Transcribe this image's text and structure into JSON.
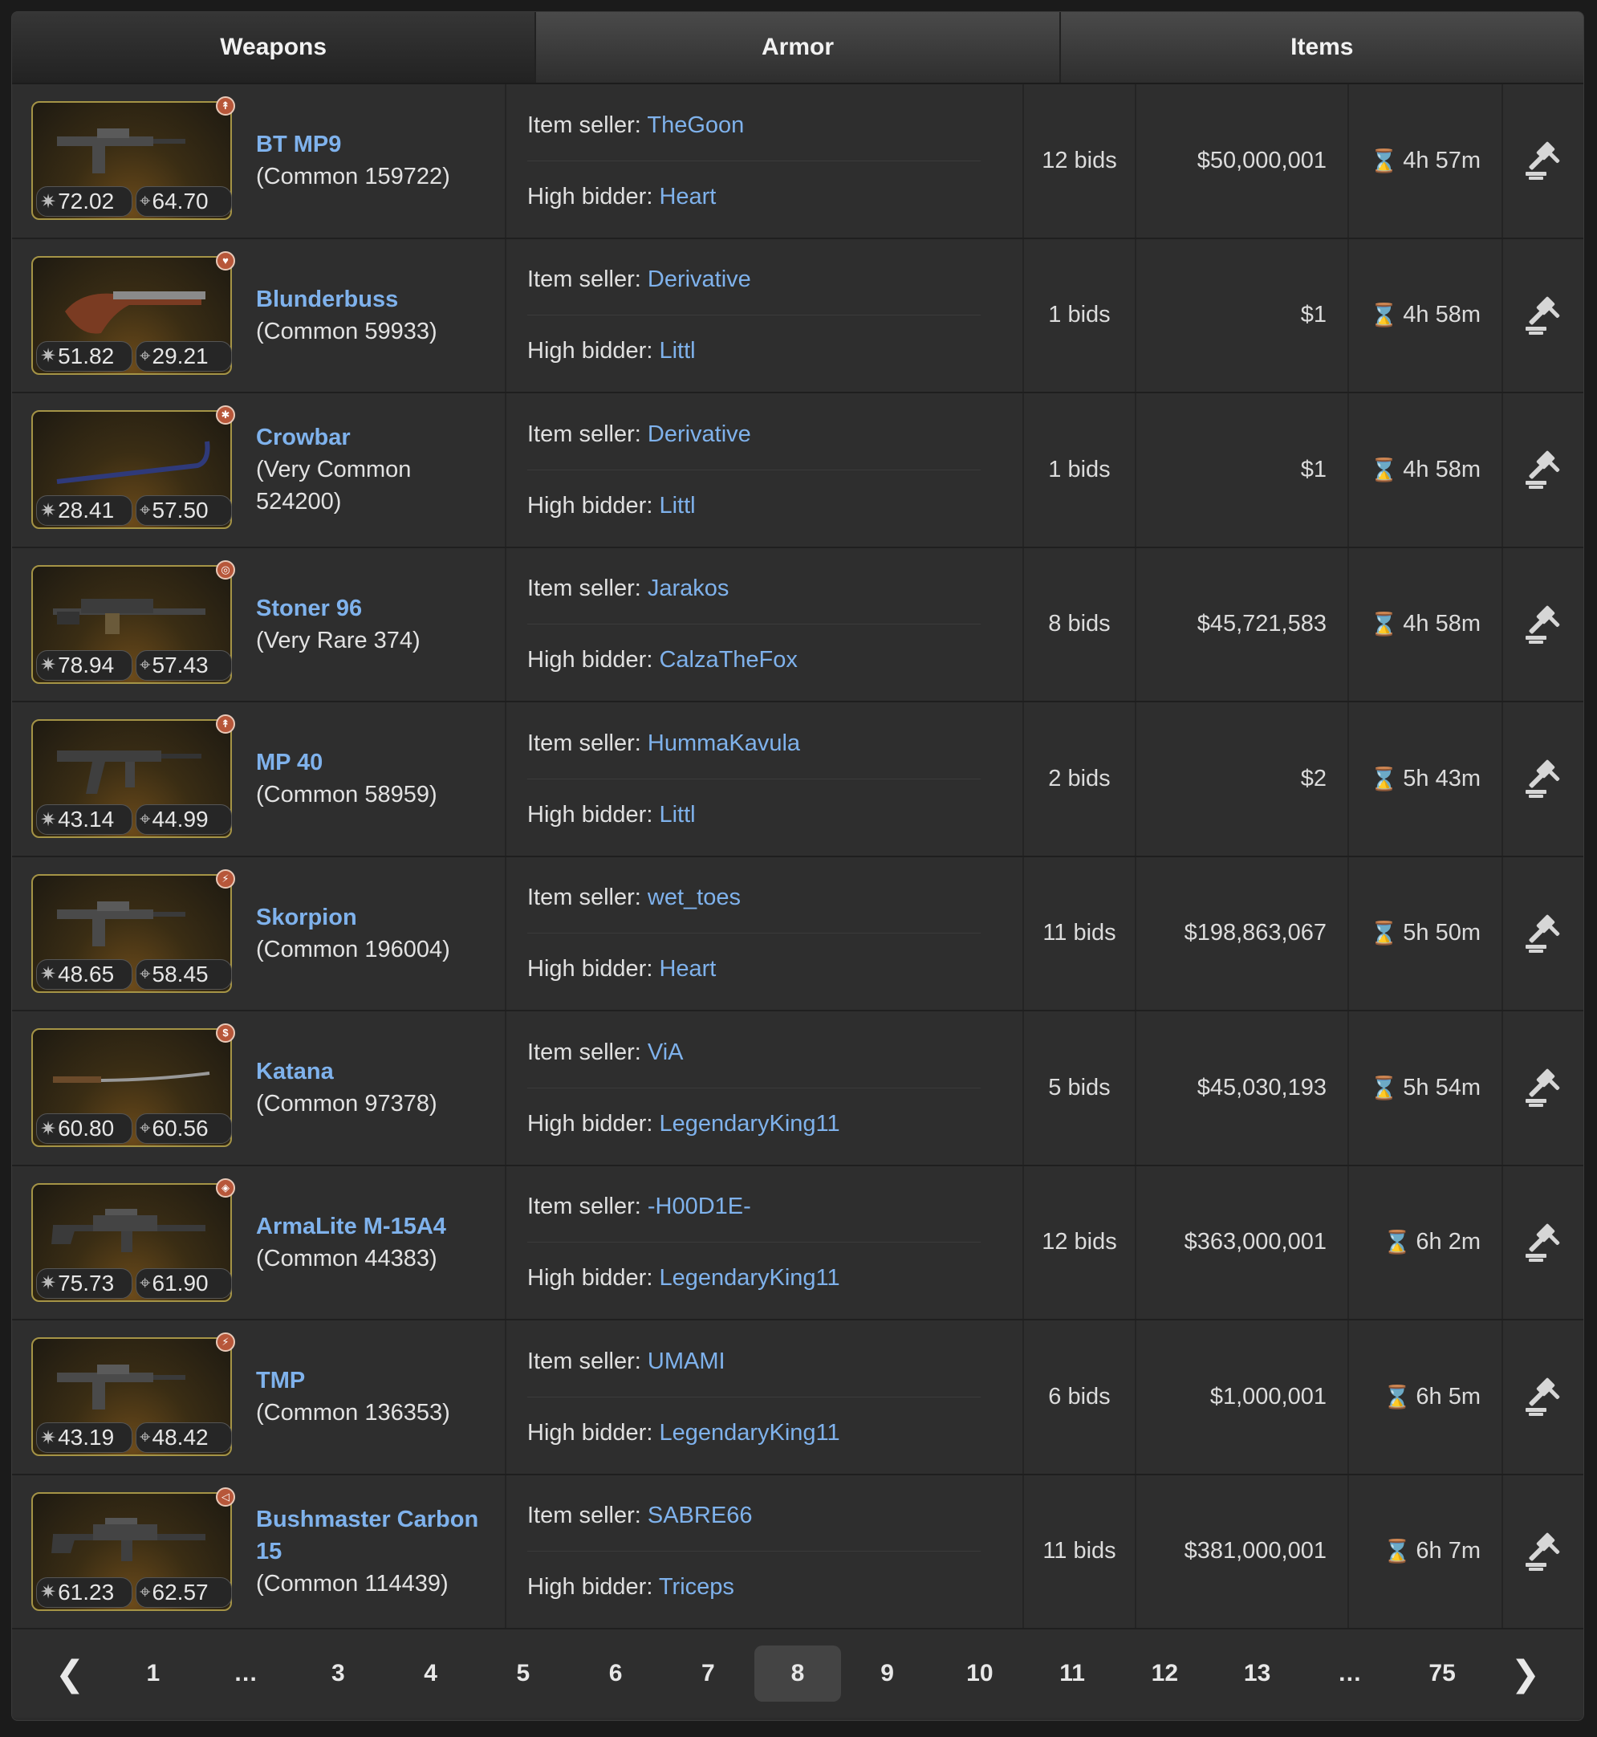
{
  "tabs": [
    "Weapons",
    "Armor",
    "Items"
  ],
  "labels": {
    "seller": "Item seller: ",
    "bidder": "High bidder: "
  },
  "rows": [
    {
      "name": "BT MP9",
      "rarity": "(Common 159722)",
      "damage": "72.02",
      "accuracy": "64.70",
      "seller": "TheGoon",
      "bidder": "Heart",
      "bids": "12 bids",
      "price": "$50,000,001",
      "time": "4h 57m",
      "badge": "↟",
      "gun": "smg"
    },
    {
      "name": "Blunderbuss",
      "rarity": "(Common 59933)",
      "damage": "51.82",
      "accuracy": "29.21",
      "seller": "Derivative",
      "bidder": "Littl",
      "bids": "1 bids",
      "price": "$1",
      "time": "4h 58m",
      "badge": "♥",
      "gun": "pistol"
    },
    {
      "name": "Crowbar",
      "rarity": "(Very Common 524200)",
      "damage": "28.41",
      "accuracy": "57.50",
      "seller": "Derivative",
      "bidder": "Littl",
      "bids": "1 bids",
      "price": "$1",
      "time": "4h 58m",
      "badge": "✱",
      "gun": "crowbar"
    },
    {
      "name": "Stoner 96",
      "rarity": "(Very Rare 374)",
      "damage": "78.94",
      "accuracy": "57.43",
      "seller": "Jarakos",
      "bidder": "CalzaTheFox",
      "bids": "8 bids",
      "price": "$45,721,583",
      "time": "4h 58m",
      "badge": "◎",
      "gun": "mg"
    },
    {
      "name": "MP 40",
      "rarity": "(Common 58959)",
      "damage": "43.14",
      "accuracy": "44.99",
      "seller": "HummaKavula",
      "bidder": "Littl",
      "bids": "2 bids",
      "price": "$2",
      "time": "5h 43m",
      "badge": "↟",
      "gun": "smg2"
    },
    {
      "name": "Skorpion",
      "rarity": "(Common 196004)",
      "damage": "48.65",
      "accuracy": "58.45",
      "seller": "wet_toes",
      "bidder": "Heart",
      "bids": "11 bids",
      "price": "$198,863,067",
      "time": "5h 50m",
      "badge": "⚡",
      "gun": "smg"
    },
    {
      "name": "Katana",
      "rarity": "(Common 97378)",
      "damage": "60.80",
      "accuracy": "60.56",
      "seller": "ViA",
      "bidder": "LegendaryKing11",
      "bids": "5 bids",
      "price": "$45,030,193",
      "time": "5h 54m",
      "badge": "$",
      "gun": "katana"
    },
    {
      "name": "ArmaLite M-15A4",
      "rarity": "(Common 44383)",
      "damage": "75.73",
      "accuracy": "61.90",
      "seller": "-H00D1E-",
      "bidder": "LegendaryKing11",
      "bids": "12 bids",
      "price": "$363,000,001",
      "time": "6h 2m",
      "badge": "◈",
      "gun": "rifle"
    },
    {
      "name": "TMP",
      "rarity": "(Common 136353)",
      "damage": "43.19",
      "accuracy": "48.42",
      "seller": "UMAMI",
      "bidder": "LegendaryKing11",
      "bids": "6 bids",
      "price": "$1,000,001",
      "time": "6h 5m",
      "badge": "⚡",
      "gun": "smg"
    },
    {
      "name": "Bushmaster Carbon 15",
      "rarity": "(Common 114439)",
      "damage": "61.23",
      "accuracy": "62.57",
      "seller": "SABRE66",
      "bidder": "Triceps",
      "bids": "11 bids",
      "price": "$381,000,001",
      "time": "6h 7m",
      "badge": "◁",
      "gun": "rifle"
    }
  ],
  "pagination": {
    "prev": "❮",
    "next": "❯",
    "pages": [
      "1",
      "…",
      "3",
      "4",
      "5",
      "6",
      "7",
      "8",
      "9",
      "10",
      "11",
      "12",
      "13",
      "…",
      "75"
    ],
    "active": "8"
  },
  "icons": {
    "damage": "damage-icon",
    "accuracy": "accuracy-icon",
    "timer": "hourglass-icon",
    "bid": "gavel-icon"
  },
  "colors": {
    "link": "#7fb2ec",
    "frame": "#a59446",
    "badge": "#b7573a"
  }
}
